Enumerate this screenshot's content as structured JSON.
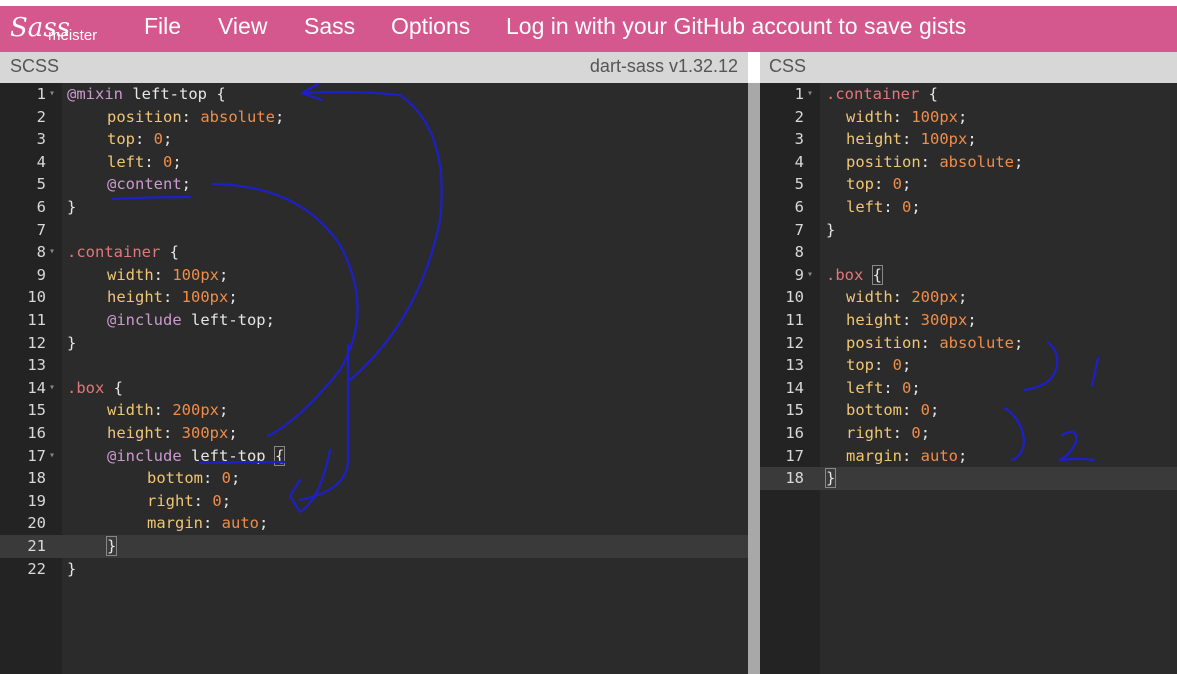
{
  "header": {
    "logo_text": "Sassmeister",
    "logo_script": "Sass",
    "logo_word": "meister",
    "menu": [
      {
        "label": "File"
      },
      {
        "label": "View"
      },
      {
        "label": "Sass"
      },
      {
        "label": "Options"
      },
      {
        "label": "Log in with your GitHub account to save gists"
      }
    ]
  },
  "scss_pane": {
    "title": "SCSS",
    "compiler": "dart-sass v1.32.12",
    "active_line": 21,
    "lines": [
      {
        "n": "1",
        "fold": true
      },
      {
        "n": "2"
      },
      {
        "n": "3"
      },
      {
        "n": "4"
      },
      {
        "n": "5"
      },
      {
        "n": "6"
      },
      {
        "n": "7"
      },
      {
        "n": "8",
        "fold": true
      },
      {
        "n": "9"
      },
      {
        "n": "10"
      },
      {
        "n": "11"
      },
      {
        "n": "12"
      },
      {
        "n": "13"
      },
      {
        "n": "14",
        "fold": true
      },
      {
        "n": "15"
      },
      {
        "n": "16"
      },
      {
        "n": "17",
        "fold": true
      },
      {
        "n": "18"
      },
      {
        "n": "19"
      },
      {
        "n": "20"
      },
      {
        "n": "21"
      },
      {
        "n": "22"
      }
    ]
  },
  "css_pane": {
    "title": "CSS",
    "active_line": 18,
    "lines": [
      {
        "n": "1",
        "fold": true
      },
      {
        "n": "2"
      },
      {
        "n": "3"
      },
      {
        "n": "4"
      },
      {
        "n": "5"
      },
      {
        "n": "6"
      },
      {
        "n": "7"
      },
      {
        "n": "8"
      },
      {
        "n": "9",
        "fold": true
      },
      {
        "n": "10"
      },
      {
        "n": "11"
      },
      {
        "n": "12"
      },
      {
        "n": "13"
      },
      {
        "n": "14"
      },
      {
        "n": "15"
      },
      {
        "n": "16"
      },
      {
        "n": "17"
      },
      {
        "n": "18"
      }
    ]
  },
  "tokens": {
    "mixin_kw": "@mixin",
    "mixin_name": " left-top ",
    "brace_open": "{",
    "brace_close": "}",
    "position": "position",
    "absolute": "absolute",
    "top": "top",
    "left": "left",
    "bottom": "bottom",
    "right": "right",
    "margin": "margin",
    "auto": "auto",
    "width": "width",
    "height": "height",
    "zero": "0",
    "colon": ": ",
    "semi": ";",
    "content": "@content",
    "include": "@include",
    "left_top": " left-top",
    "left_top_sp": " left-top ",
    "container": ".container",
    "box": ".box",
    "v100": "100",
    "v200": "200",
    "v300": "300",
    "px": "px",
    "sp": " "
  },
  "annotations": {
    "label_1": "1",
    "label_2": "2",
    "ink_color": "#1d1fc9"
  },
  "colors": {
    "brand": "#d4588e",
    "editor_bg": "#2b2b2b",
    "selector": "#e2777a",
    "property": "#f0c674",
    "number": "#f08d49",
    "at_rule": "#cc99cd"
  }
}
